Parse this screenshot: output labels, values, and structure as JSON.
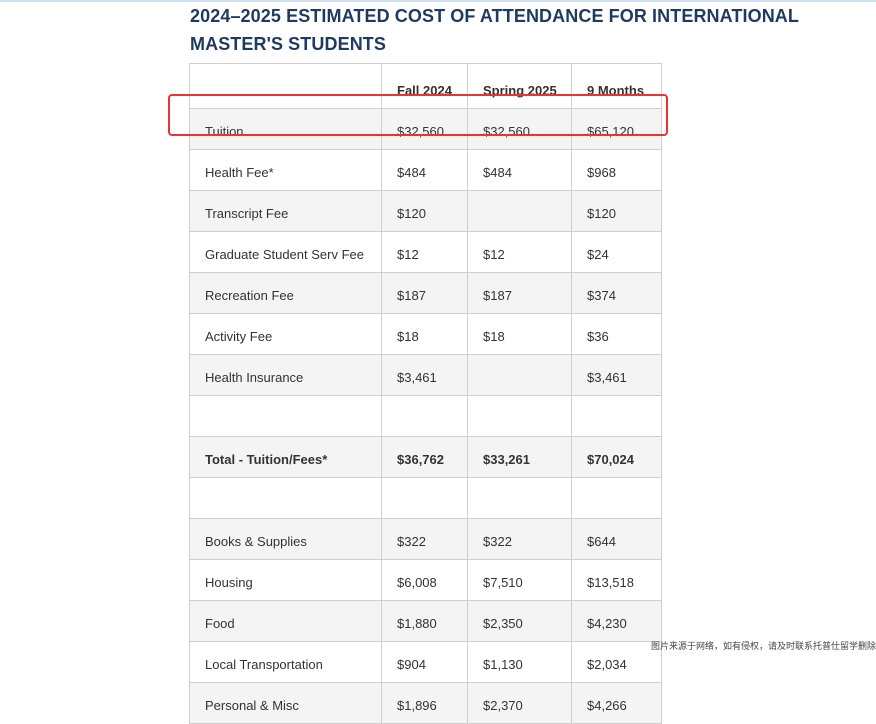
{
  "page": {
    "heading": "2024–2025 ESTIMATED COST OF ATTENDANCE FOR INTERNATIONAL MASTER'S STUDENTS"
  },
  "table": {
    "headers": [
      "",
      "Fall 2024",
      "Spring 2025",
      "9 Months"
    ],
    "rows": [
      [
        "Tuition",
        "$32,560",
        "$32,560",
        "$65,120"
      ],
      [
        "Health Fee*",
        "$484",
        "$484",
        "$968"
      ],
      [
        "Transcript Fee",
        "$120",
        "",
        "$120"
      ],
      [
        "Graduate Student Serv Fee",
        "$12",
        "$12",
        "$24"
      ],
      [
        "Recreation Fee",
        "$187",
        "$187",
        "$374"
      ],
      [
        "Activity Fee",
        "$18",
        "$18",
        "$36"
      ],
      [
        "Health Insurance",
        "$3,461",
        "",
        "$3,461"
      ],
      [
        "",
        "",
        "",
        ""
      ],
      [
        "Total - Tuition/Fees*",
        "$36,762",
        "$33,261",
        "$70,024"
      ],
      [
        "",
        "",
        "",
        ""
      ],
      [
        "Books & Supplies",
        "$322",
        "$322",
        "$644"
      ],
      [
        "Housing",
        "$6,008",
        "$7,510",
        "$13,518"
      ],
      [
        "Food",
        "$1,880",
        "$2,350",
        "$4,230"
      ],
      [
        "Local Transportation",
        "$904",
        "$1,130",
        "$2,034"
      ],
      [
        "Personal & Misc",
        "$1,896",
        "$2,370",
        "$4,266"
      ]
    ]
  },
  "watermark": "图片来源于网络，如有侵权，请及时联系托普仕留学删除",
  "colors": {
    "heading": "#1f3a5f",
    "highlight_border": "#e83434",
    "row_alt": "#f4f4f4",
    "grid": "#d0d0d0"
  }
}
